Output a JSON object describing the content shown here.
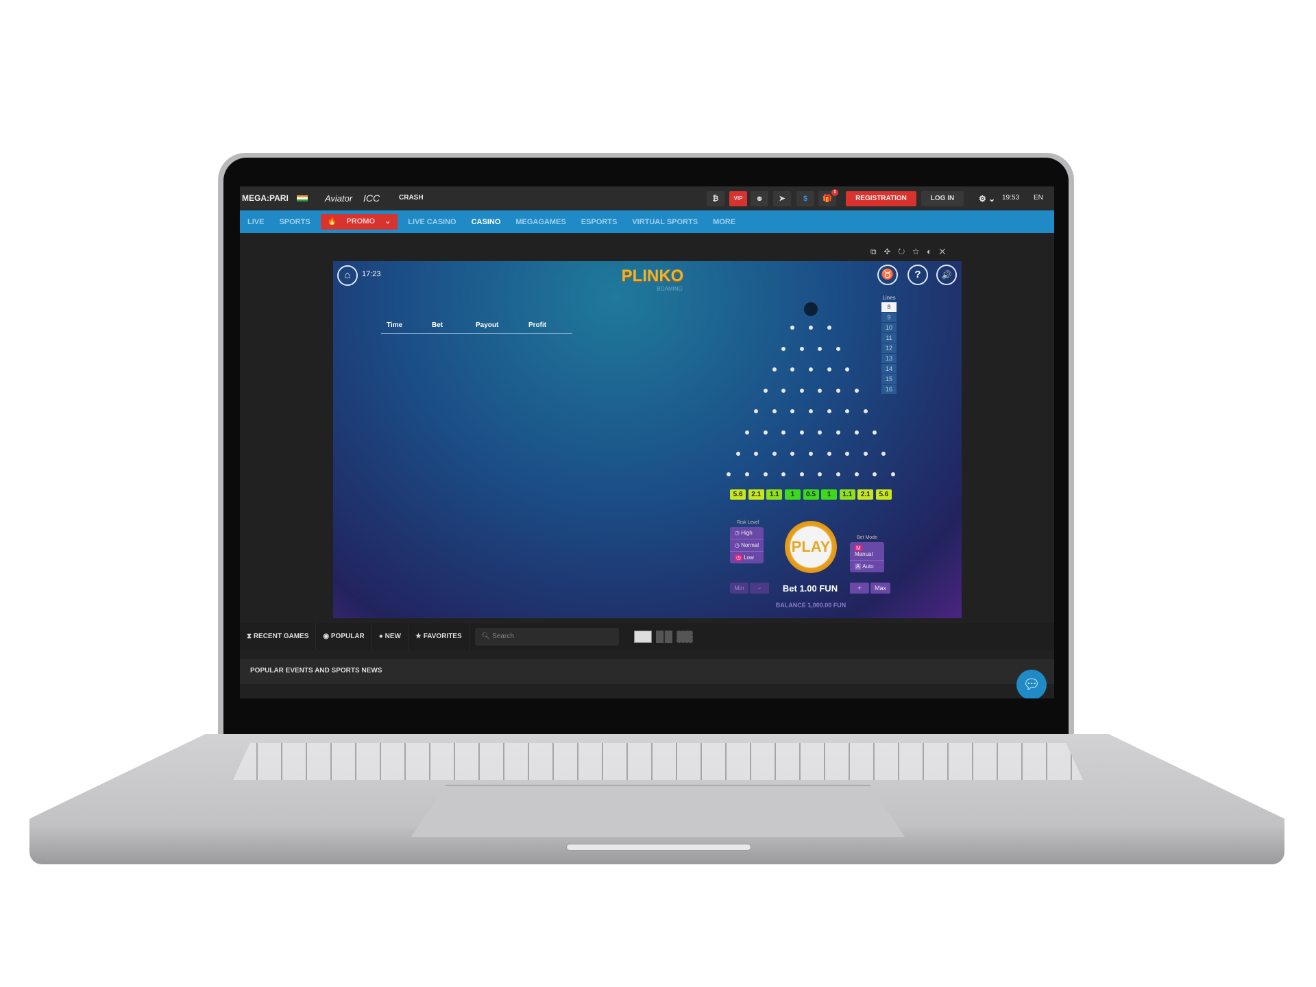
{
  "header": {
    "brand": "MEGA:PARI",
    "partners": [
      "Aviator",
      "ICC",
      "CRASH"
    ],
    "icons": [
      "bitcoin-icon",
      "vip-icon",
      "agent-icon",
      "telegram-icon",
      "dollar-icon",
      "gift-icon"
    ],
    "vip": "VIP",
    "gift_badge": "1",
    "registration": "REGISTRATION",
    "login": "LOG IN",
    "time": "19:53",
    "language": "EN"
  },
  "nav": {
    "items": [
      "LIVE",
      "SPORTS",
      "PROMO",
      "LIVE CASINO",
      "CASINO",
      "MEGAGAMES",
      "ESPORTS",
      "VIRTUAL SPORTS",
      "MORE"
    ],
    "active": "CASINO"
  },
  "game": {
    "clock": "17:23",
    "title": "PLINKO",
    "provider": "BGAMING",
    "table_headers": [
      "Time",
      "Bet",
      "Payout",
      "Profit"
    ],
    "lines_label": "Lines",
    "lines": [
      "8",
      "9",
      "10",
      "11",
      "12",
      "13",
      "14",
      "15",
      "16"
    ],
    "lines_selected": "8",
    "multipliers": [
      "5.6",
      "2.1",
      "1.1",
      "1",
      "0.5",
      "1",
      "1.1",
      "2.1",
      "5.6"
    ],
    "risk_label": "Risk Level",
    "risk": [
      "High",
      "Normal",
      "Low"
    ],
    "risk_selected": "Low",
    "play": "PLAY",
    "bet_mode_label": "Bet Mode",
    "bet_modes": [
      "Manual",
      "Auto"
    ],
    "bet_mode_selected": "Manual",
    "min": "Min",
    "minus": "−",
    "plus": "+",
    "max": "Max",
    "bet": "Bet 1.00 FUN",
    "balance": "BALANCE 1,000.00 FUN"
  },
  "bottom": {
    "tabs": [
      "RECENT GAMES",
      "POPULAR",
      "NEW",
      "FAVORITES"
    ],
    "search_placeholder": "Search",
    "section": "POPULAR EVENTS AND SPORTS NEWS"
  },
  "colors": {
    "nav": "#1f8ac6",
    "registration": "#d9332f",
    "multiplier_edge": "#c8e81c",
    "multiplier_center": "#3ed81c"
  }
}
